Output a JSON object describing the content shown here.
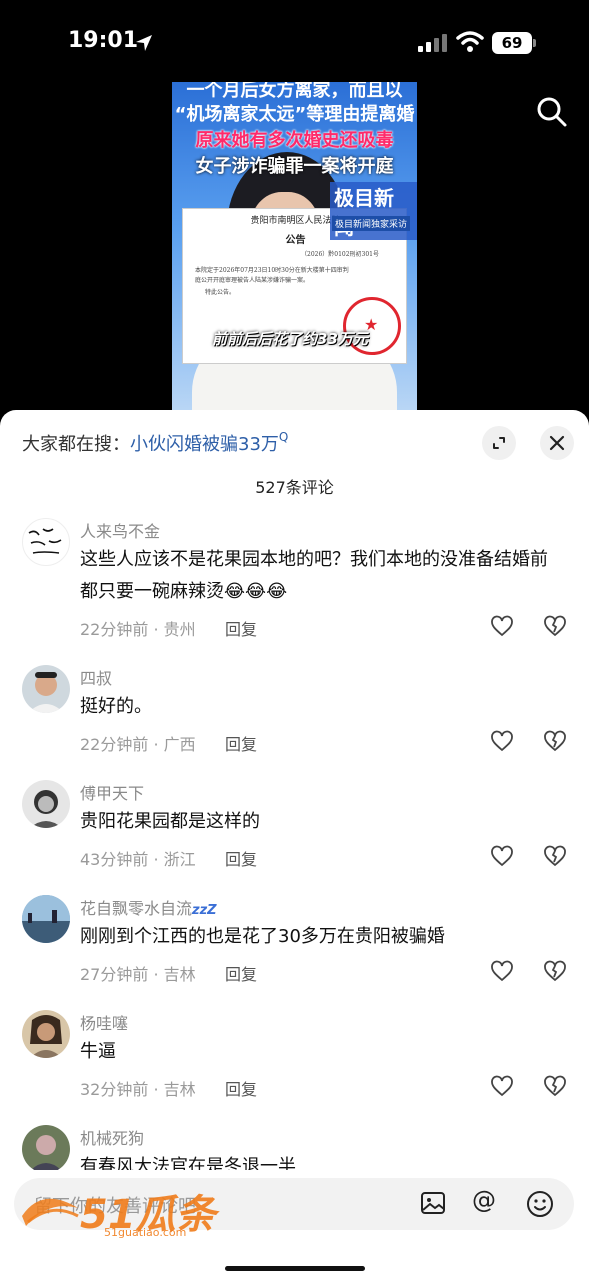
{
  "status_bar": {
    "time": "19:01",
    "battery": "69"
  },
  "video": {
    "caption_lines": [
      "一个月后女方离家，而且以",
      "“机场离家太远”等理由提离婚",
      "原来她有多次婚史还吸毒",
      "女子涉诈骗罪一案将开庭"
    ],
    "brand": "极目新闻",
    "brand_sub": "极目新闻独家采访",
    "notice_court": "贵阳市南明区人民法院",
    "notice_title": "公告",
    "notice_case": "（2026）黔0102刑初301号",
    "notice_body1": "本院定于2026年07月23日10时30分在新大楼第十四审判",
    "notice_body2": "庭公开开庭审理被告人陆某涉嫌诈骗一案。",
    "notice_body3": "特此公告。",
    "amount_caption": "前前后后花了约33万元"
  },
  "sheet": {
    "search_hint_prefix": "大家都在搜：",
    "search_hint_keyword": "小伙闪婚被骗33万",
    "comment_count": "527条评论"
  },
  "comments": [
    {
      "name": "人来鸟不金",
      "text": "这些人应该不是花果园本地的吧？我们本地的没准备结婚前都只要一碗麻辣烫😂😂😂",
      "time_loc": "22分钟前 · 贵州",
      "reply": "回复"
    },
    {
      "name": "四叔",
      "text": "挺好的。",
      "time_loc": "22分钟前 · 广西",
      "reply": "回复"
    },
    {
      "name": "傅甲天下",
      "text": "贵阳花果园都是这样的",
      "time_loc": "43分钟前 · 浙江",
      "reply": "回复"
    },
    {
      "name": "花自飘零水自流",
      "name_suffix": "zzZ",
      "text": "刚刚到个江西的也是花了30多万在贵阳被骗婚",
      "time_loc": "27分钟前 · 吉林",
      "reply": "回复"
    },
    {
      "name": "杨哇噻",
      "text": "牛逼",
      "time_loc": "32分钟前 · 吉林",
      "reply": "回复"
    },
    {
      "name": "机械死狗",
      "text": "有春风大法官在是冬退一半",
      "time_loc": "",
      "reply": ""
    }
  ],
  "input": {
    "placeholder": "留下你的友善评论吧"
  },
  "watermark": {
    "text": "51瓜条",
    "url": "51guatiao.com"
  },
  "colors": {
    "keyword": "#2e5fa8",
    "watermark": "#f07c1a",
    "caption_red": "#ff2a6a"
  }
}
